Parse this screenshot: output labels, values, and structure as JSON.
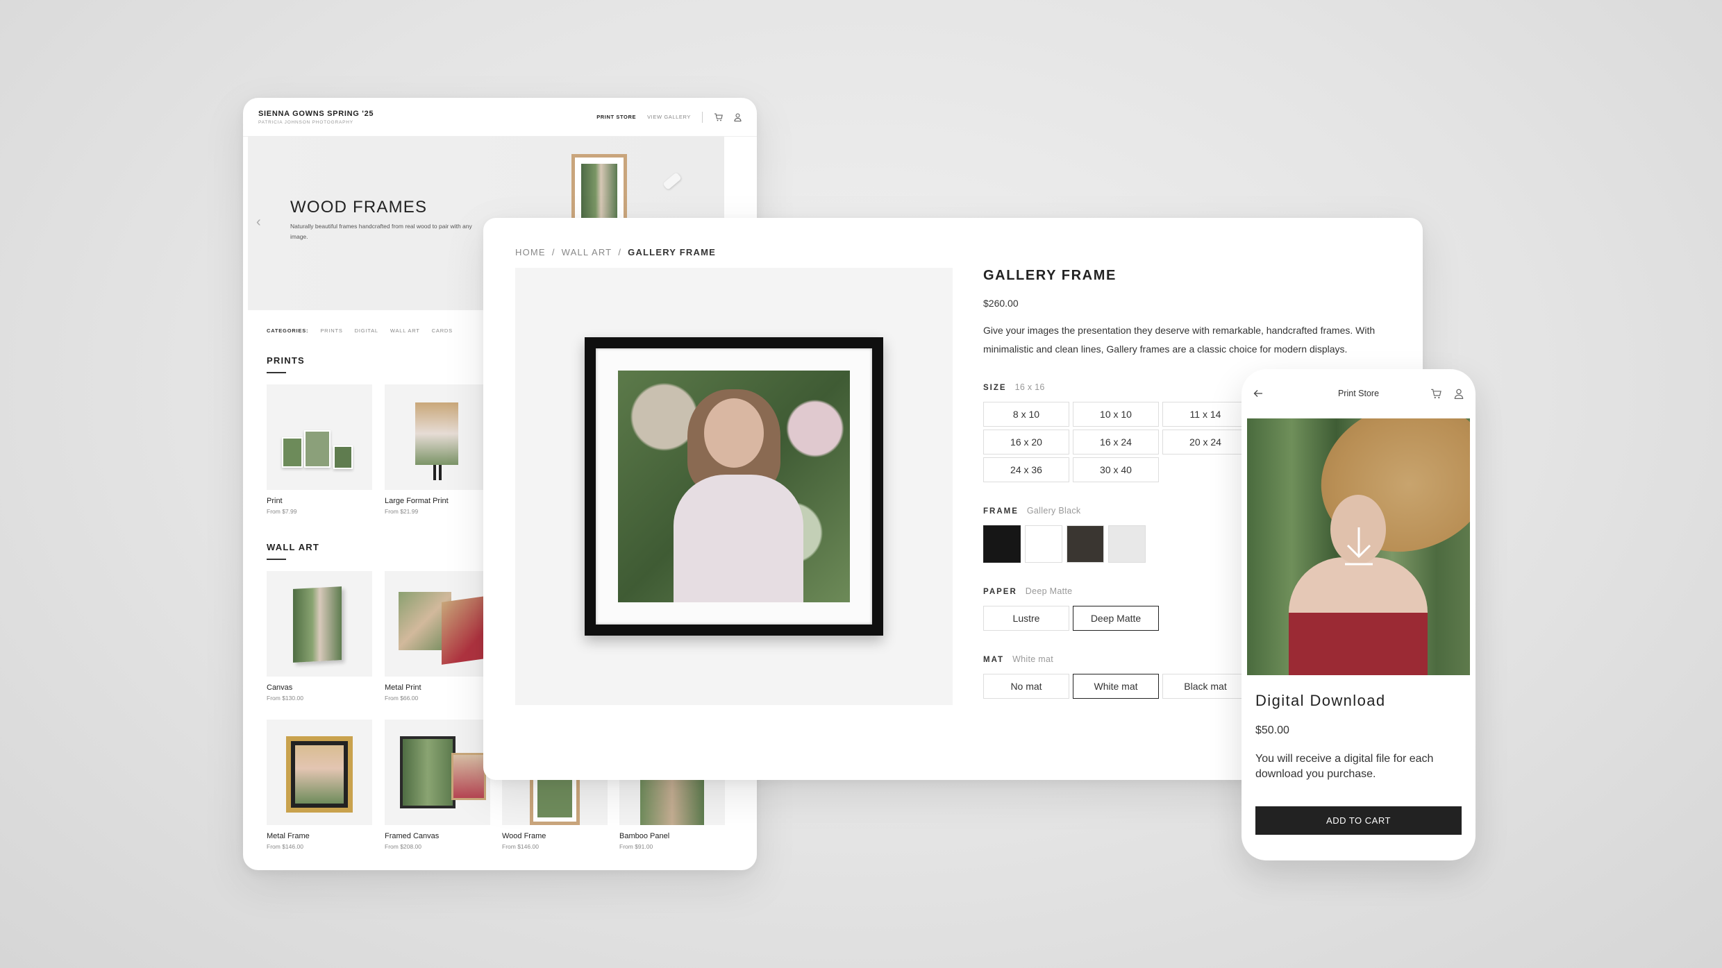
{
  "store": {
    "brand_title": "SIENNA GOWNS SPRING '25",
    "brand_subtitle": "PATRICIA JOHNSON PHOTOGRAPHY",
    "nav_print_store": "PRINT STORE",
    "nav_view_gallery": "VIEW GALLERY",
    "hero": {
      "title": "WOOD FRAMES",
      "description": "Naturally beautiful frames handcrafted from real wood to pair with any image.",
      "prev_icon": "chevron-left-icon"
    },
    "categories": {
      "label": "CATEGORIES:",
      "items": [
        "PRINTS",
        "DIGITAL",
        "WALL ART",
        "CARDS"
      ]
    },
    "sections": {
      "prints": "PRINTS",
      "wall_art": "WALL ART"
    },
    "prints": [
      {
        "name": "Print",
        "price": "From $7.99"
      },
      {
        "name": "Large Format Print",
        "price": "From $21.99"
      }
    ],
    "wall_art": [
      {
        "name": "Canvas",
        "price": "From $130.00"
      },
      {
        "name": "Metal Print",
        "price": "From $66.00"
      },
      {
        "name": "Metal Frame",
        "price": "From $146.00"
      },
      {
        "name": "Framed Canvas",
        "price": "From $208.00"
      },
      {
        "name": "Wood Frame",
        "price": "From $146.00"
      },
      {
        "name": "Bamboo Panel",
        "price": "From $91.00"
      }
    ]
  },
  "product": {
    "breadcrumb": [
      "HOME",
      "WALL ART",
      "GALLERY FRAME"
    ],
    "title": "GALLERY FRAME",
    "price": "$260.00",
    "description": "Give your images the presentation they deserve with remarkable, handcrafted frames. With minimalistic and clean lines, Gallery frames are a classic choice for modern displays.",
    "size": {
      "label": "SIZE",
      "selected": "16 x 16",
      "options": [
        "8 x 10",
        "10 x 10",
        "11 x 14",
        "16 x 20",
        "16 x 24",
        "20 x 24",
        "24 x 36",
        "30 x 40"
      ]
    },
    "frame": {
      "label": "FRAME",
      "selected": "Gallery Black",
      "swatches": [
        "#161616",
        "#ffffff",
        "#3a3631",
        "#e8e8e8"
      ]
    },
    "paper": {
      "label": "PAPER",
      "selected": "Deep Matte",
      "options": [
        "Lustre",
        "Deep Matte"
      ]
    },
    "mat": {
      "label": "MAT",
      "selected": "White mat",
      "options": [
        "No mat",
        "White mat",
        "Black mat"
      ]
    }
  },
  "phone": {
    "title": "Print Store",
    "product_name": "Digital Download",
    "price": "$50.00",
    "description": "You will receive a digital file for each download you purchase.",
    "cta": "ADD TO CART"
  }
}
